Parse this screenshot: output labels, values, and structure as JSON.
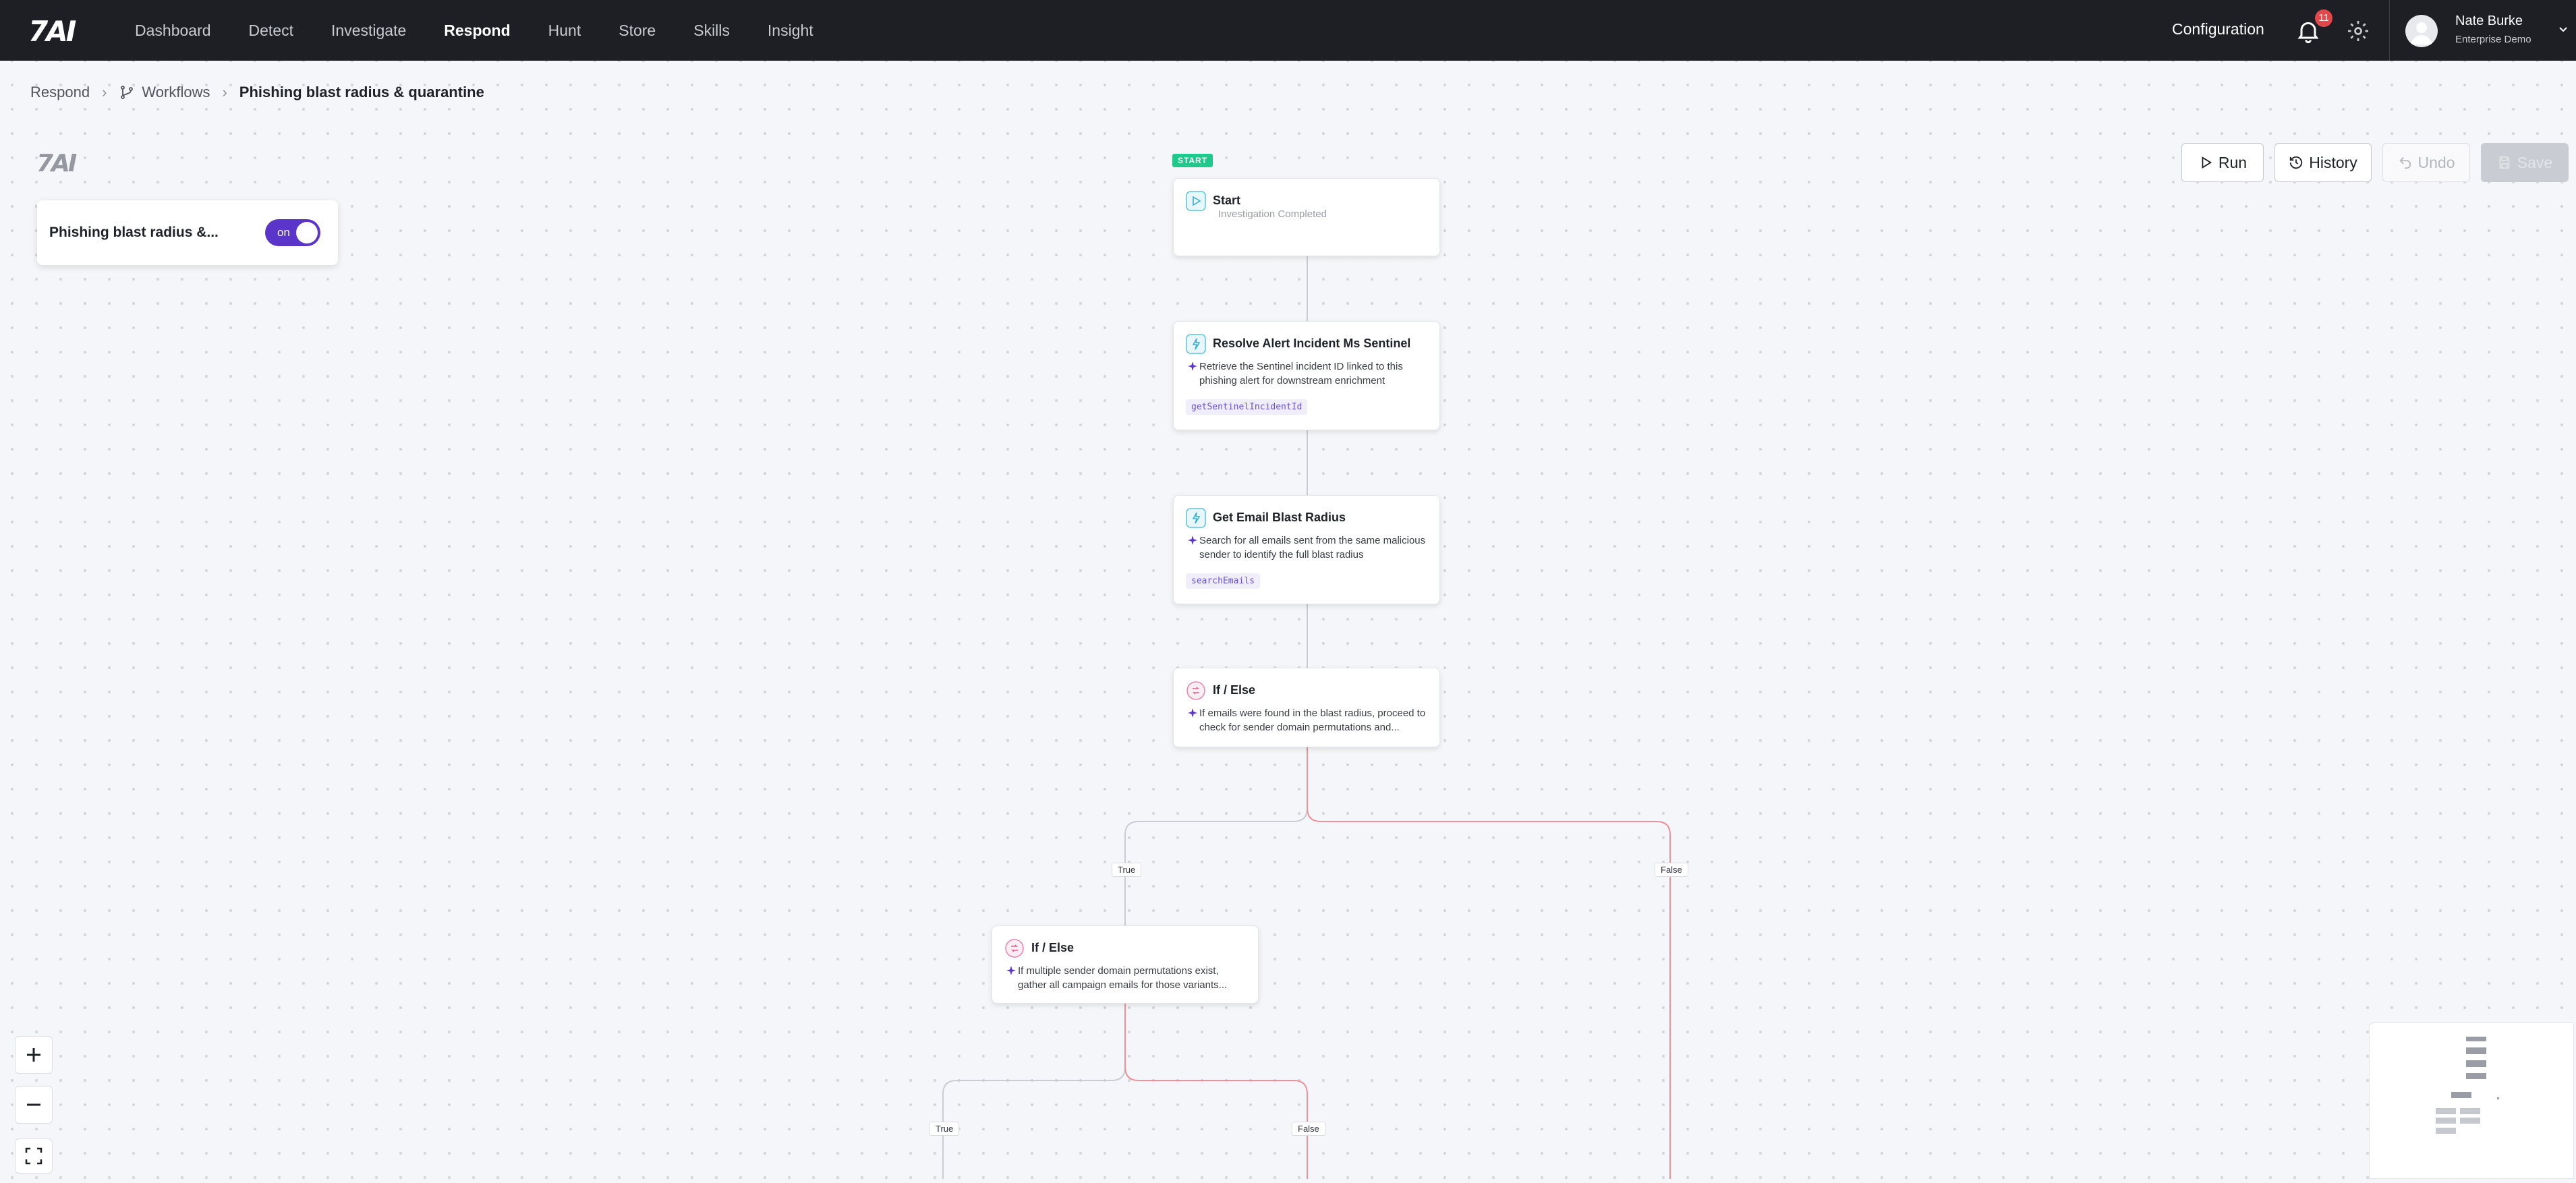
{
  "brand": {
    "logo_text": "7AI"
  },
  "nav": {
    "items": [
      "Dashboard",
      "Detect",
      "Investigate",
      "Respond",
      "Hunt",
      "Store",
      "Skills",
      "Insight"
    ],
    "active": "Respond",
    "configuration": "Configuration",
    "notifications_count": "11"
  },
  "user": {
    "name": "Nate Burke",
    "org": "Enterprise Demo"
  },
  "breadcrumb": {
    "root": "Respond",
    "section": "Workflows",
    "current": "Phishing blast radius & quarantine"
  },
  "workflow": {
    "name": "Phishing blast radius &...",
    "toggle_label": "on",
    "enabled": true
  },
  "toolbar": {
    "run": "Run",
    "history": "History",
    "undo": "Undo",
    "save": "Save"
  },
  "nodes": {
    "start": {
      "badge": "START",
      "title": "Start",
      "subtitle": "Investigation Completed"
    },
    "resolve": {
      "title": "Resolve Alert Incident Ms Sentinel",
      "description": "Retrieve the Sentinel incident ID linked to this phishing alert for downstream enrichment",
      "code": "getSentinelIncidentId"
    },
    "blast": {
      "title": "Get Email Blast Radius",
      "description": "Search for all emails sent from the same malicious sender to identify the full blast radius",
      "code": "searchEmails"
    },
    "ifelse1": {
      "title": "If / Else",
      "description": "If emails were found in the blast radius, proceed to check for sender domain permutations and..."
    },
    "ifelse2": {
      "title": "If / Else",
      "description": "If multiple sender domain permutations exist, gather all campaign emails for those variants..."
    }
  },
  "edges": {
    "true_label": "True",
    "false_label": "False"
  },
  "colors": {
    "accent": "#5b35c9",
    "start_green": "#1ec98b",
    "false_edge": "#ef8f98",
    "true_edge": "#c9ccd2"
  }
}
